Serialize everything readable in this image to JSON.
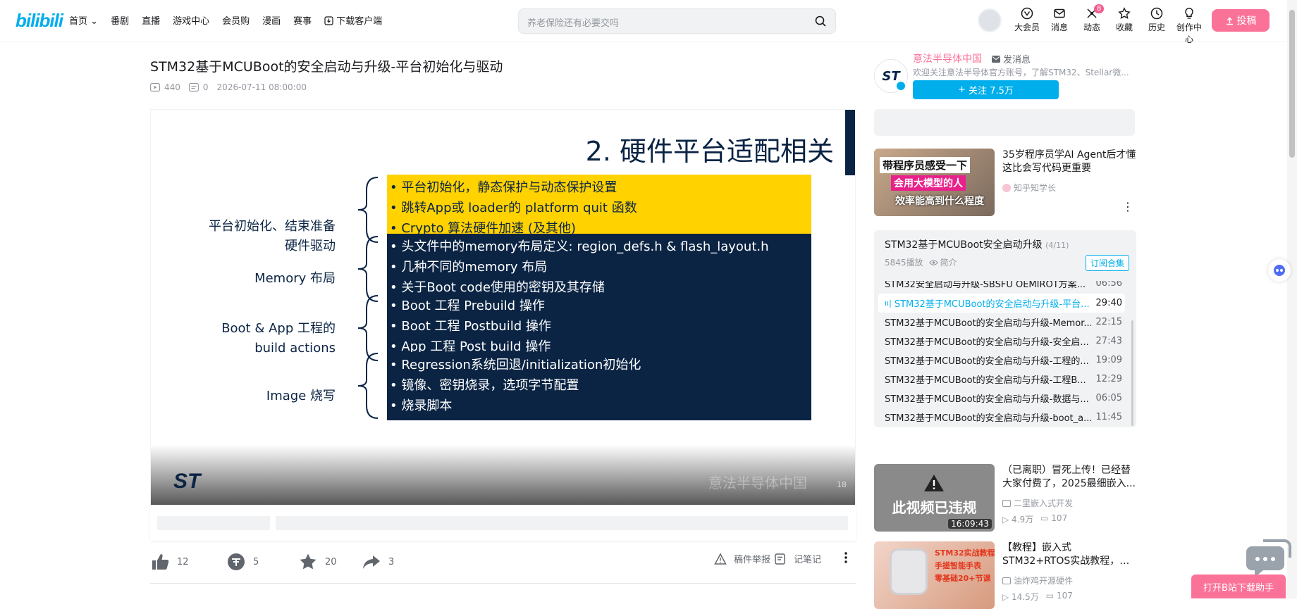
{
  "nav": {
    "logo": "bilibili",
    "items": [
      "首页",
      "番剧",
      "直播",
      "游戏中心",
      "会员购",
      "漫画",
      "赛事",
      "下载客户端"
    ],
    "search_placeholder": "养老保险还有必要交吗",
    "right_items": [
      {
        "label": "大会员",
        "icon": "vip-icon"
      },
      {
        "label": "消息",
        "icon": "mail-icon"
      },
      {
        "label": "动态",
        "icon": "dynamic-icon",
        "badge": "8"
      },
      {
        "label": "收藏",
        "icon": "star-icon"
      },
      {
        "label": "历史",
        "icon": "clock-icon"
      },
      {
        "label": "创作中心",
        "icon": "bulb-icon"
      }
    ],
    "upload_label": "投稿"
  },
  "video": {
    "title": "STM32基于MCUBoot的安全启动与升级-平台初始化与驱动",
    "views": "440",
    "danmaku": "0",
    "date": "2026-07-11 08:00:00"
  },
  "slide": {
    "heading": "2. 硬件平台适配相关",
    "groups": [
      {
        "label_lines": [
          "平台初始化、结束准备",
          "硬件驱动"
        ],
        "style": "yellow",
        "bullets": [
          "• 平台初始化，静态保护与动态保护设置",
          "• 跳转App或 loader的 platform quit 函数",
          "• Crypto 算法硬件加速 (及其他)"
        ]
      },
      {
        "label_lines": [
          "Memory 布局"
        ],
        "style": "navy",
        "bullets": [
          "• 头文件中的memory布局定义: region_defs.h & flash_layout.h",
          "• 几种不同的memory 布局",
          "• 关于Boot code使用的密钥及其存储"
        ]
      },
      {
        "label_lines": [
          "Boot & App 工程的",
          "build actions"
        ],
        "style": "navy",
        "bullets": [
          "• Boot 工程 Prebuild 操作",
          "• Boot 工程 Postbuild 操作",
          "• App 工程 Post build 操作"
        ]
      },
      {
        "label_lines": [
          "Image 烧写"
        ],
        "style": "navy",
        "bullets": [
          "• Regression系统回退/initialization初始化",
          "• 镜像、密钥烧录，选项字节配置",
          "• 烧录脚本"
        ]
      }
    ],
    "logo": "ST",
    "watermark": "意法半导体中国",
    "page_number": "18"
  },
  "actions": {
    "like": "12",
    "coin": "5",
    "favorite": "20",
    "share": "3",
    "report": "稿件举报",
    "notes": "记笔记"
  },
  "uploader": {
    "name": "意法半导体中国",
    "message_label": "发消息",
    "description": "欢迎关注意法半导体官方账号，了解STM32、Stellar微...",
    "follow_label": "关注 7.5万",
    "avatar_text": "ST"
  },
  "recommend_top": {
    "title": "35岁程序员学AI Agent后才懂这比会写代码更重要",
    "up": "知乎知学长",
    "thumb_lines": [
      "带程序员感受一下",
      "会用大模型的人",
      "效率能高到什么程度"
    ]
  },
  "collection": {
    "title": "STM32基于MCUBoot安全启动升级",
    "count": "(4/11)",
    "plays": "5845播放",
    "intro": "简介",
    "subscribe": "订阅合集",
    "episodes": [
      {
        "title": "STM32安全启动与升级-SBSFU OEMIROT方案...",
        "duration": "06:56"
      },
      {
        "title": "STM32基于MCUBoot的安全启动与升级-平台...",
        "duration": "29:40",
        "active": true
      },
      {
        "title": "STM32基于MCUBoot的安全启动与升级-Memor...",
        "duration": "22:15"
      },
      {
        "title": "STM32基于MCUBoot的安全启动与升级-安全启...",
        "duration": "27:43"
      },
      {
        "title": "STM32基于MCUBoot的安全启动与升级-工程的...",
        "duration": "19:09"
      },
      {
        "title": "STM32基于MCUBoot的安全启动与升级-工程B...",
        "duration": "12:29"
      },
      {
        "title": "STM32基于MCUBoot的安全启动与升级-数据与...",
        "duration": "06:05"
      },
      {
        "title": "STM32基于MCUBoot的安全启动与升级-boot_a...",
        "duration": "11:45"
      }
    ]
  },
  "recommend_2": {
    "title": "（已离职）冒死上传！已经替大家付费了，2025最细嵌入...",
    "up": "二里嵌入式开发",
    "views": "4.9万",
    "comments": "107",
    "duration": "16:09:43",
    "thumb_text": "此视频已违规"
  },
  "recommend_3": {
    "title": "【教程】嵌入式STM32+RTOS实战教程，手搓智能手表，...",
    "up": "油炸鸡开源硬件",
    "views": "14.5万",
    "comments": "107",
    "thumb_lines": [
      "STM32实战教程",
      "手搓智能手表",
      "零基础20+节课"
    ]
  },
  "floating": {
    "download_label": "打开B站下载助手"
  }
}
